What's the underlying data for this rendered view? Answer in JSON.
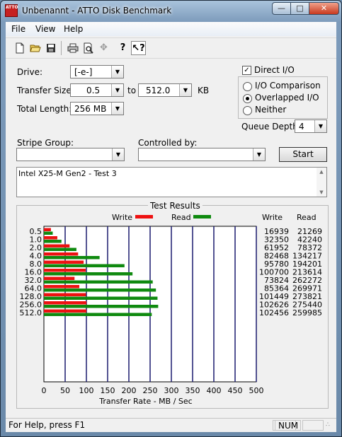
{
  "window": {
    "title": "Unbenannt - ATTO Disk Benchmark",
    "app_icon_text": "ATTO"
  },
  "menu": {
    "file": "File",
    "view": "View",
    "help": "Help"
  },
  "toolbar": {
    "icons": [
      "new-icon",
      "open-icon",
      "save-icon",
      "print-icon",
      "print-preview-icon",
      "move-icon",
      "help-icon",
      "context-help-icon"
    ]
  },
  "settings": {
    "drive_label": "Drive:",
    "drive_value": "[-e-]",
    "transfer_size_label": "Transfer Size:",
    "transfer_from": "0.5",
    "to_label": "to",
    "transfer_to": "512.0",
    "unit": "KB",
    "total_length_label": "Total Length:",
    "total_length_value": "256 MB",
    "direct_io_label": "Direct I/O",
    "direct_io_checked": true,
    "mode_options": [
      "I/O Comparison",
      "Overlapped I/O",
      "Neither"
    ],
    "mode_selected": "Overlapped I/O",
    "queue_depth_label": "Queue Depth:",
    "queue_depth_value": "4",
    "stripe_group_label": "Stripe Group:",
    "controlled_by_label": "Controlled by:",
    "start_label": "Start",
    "description": "Intel X25-M Gen2 - Test 3"
  },
  "results": {
    "title": "Test Results",
    "legend_write": "Write",
    "legend_read": "Read",
    "col_write": "Write",
    "col_read": "Read",
    "write_color": "#ee1111",
    "read_color": "#0f8a0f"
  },
  "chart_data": {
    "type": "bar",
    "orientation": "horizontal",
    "categories": [
      "0.5",
      "1.0",
      "2.0",
      "4.0",
      "8.0",
      "16.0",
      "32.0",
      "64.0",
      "128.0",
      "256.0",
      "512.0"
    ],
    "series": [
      {
        "name": "Write",
        "values": [
          16939,
          32350,
          61952,
          82468,
          95780,
          100700,
          73824,
          85364,
          101449,
          102626,
          102456
        ]
      },
      {
        "name": "Read",
        "values": [
          21269,
          42240,
          78372,
          134217,
          194201,
          213614,
          262272,
          269971,
          273821,
          275440,
          259985
        ]
      }
    ],
    "write_labels": [
      "16939",
      "32350",
      "61952",
      "82468",
      "95780",
      "100700",
      "73824",
      "85364",
      "101449",
      "102626",
      "102456"
    ],
    "read_labels": [
      "21269",
      "42240",
      "78372",
      "134217",
      "194201",
      "213614",
      "262272",
      "269971",
      "273821",
      "275440",
      "259985"
    ],
    "xticks": [
      "0",
      "50",
      "100",
      "150",
      "200",
      "250",
      "300",
      "350",
      "400",
      "450",
      "500"
    ],
    "xlabel": "Transfer Rate - MB / Sec",
    "xlim": [
      0,
      500
    ],
    "grid": true
  },
  "status": {
    "help_text": "For Help, press F1",
    "num": "NUM"
  }
}
